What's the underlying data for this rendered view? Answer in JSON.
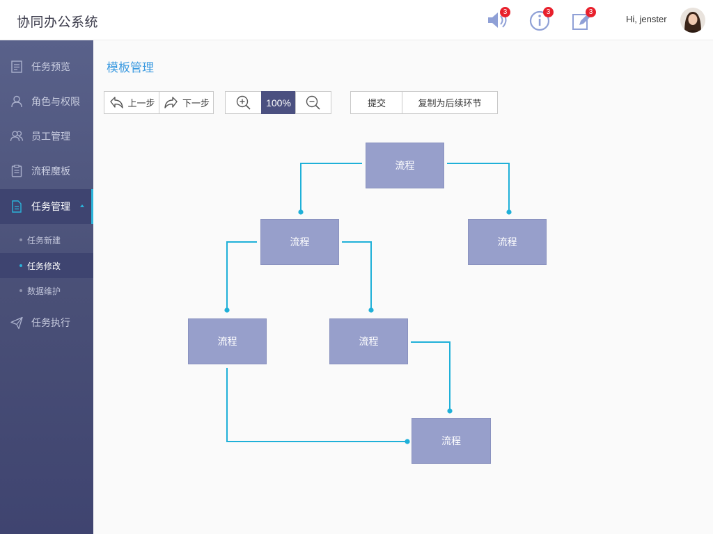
{
  "header": {
    "app_title": "协同办公系统",
    "greeting": "Hi, jenster",
    "icons": [
      {
        "name": "speaker-icon",
        "badge": "3"
      },
      {
        "name": "info-icon",
        "badge": "3"
      },
      {
        "name": "edit-icon",
        "badge": "3"
      }
    ]
  },
  "sidebar": {
    "items": [
      {
        "label": "任务预览",
        "icon": "doc-icon"
      },
      {
        "label": "角色与权限",
        "icon": "user-icon"
      },
      {
        "label": "员工管理",
        "icon": "users-icon"
      },
      {
        "label": "流程魔板",
        "icon": "clipboard-icon"
      },
      {
        "label": "任务管理",
        "icon": "file-icon",
        "active": true
      },
      {
        "label": "任务执行",
        "icon": "send-icon"
      }
    ],
    "subitems": [
      {
        "label": "任务新建"
      },
      {
        "label": "任务修改",
        "active": true
      },
      {
        "label": "数据维护"
      }
    ]
  },
  "main": {
    "title": "模板管理",
    "toolbar": {
      "undo_label": "上一步",
      "redo_label": "下一步",
      "zoom": "100%",
      "submit_label": "提交",
      "copy_label": "复制为后续环节"
    }
  },
  "diagram": {
    "nodes": [
      {
        "label": "流程"
      },
      {
        "label": "流程"
      },
      {
        "label": "流程"
      },
      {
        "label": "流程"
      },
      {
        "label": "流程"
      },
      {
        "label": "流程"
      }
    ]
  },
  "colors": {
    "accent": "#2bb3d9",
    "node_fill": "#979fcb",
    "sidebar": "#4a5077",
    "title": "#3b9ae0",
    "badge": "#e8202c"
  }
}
